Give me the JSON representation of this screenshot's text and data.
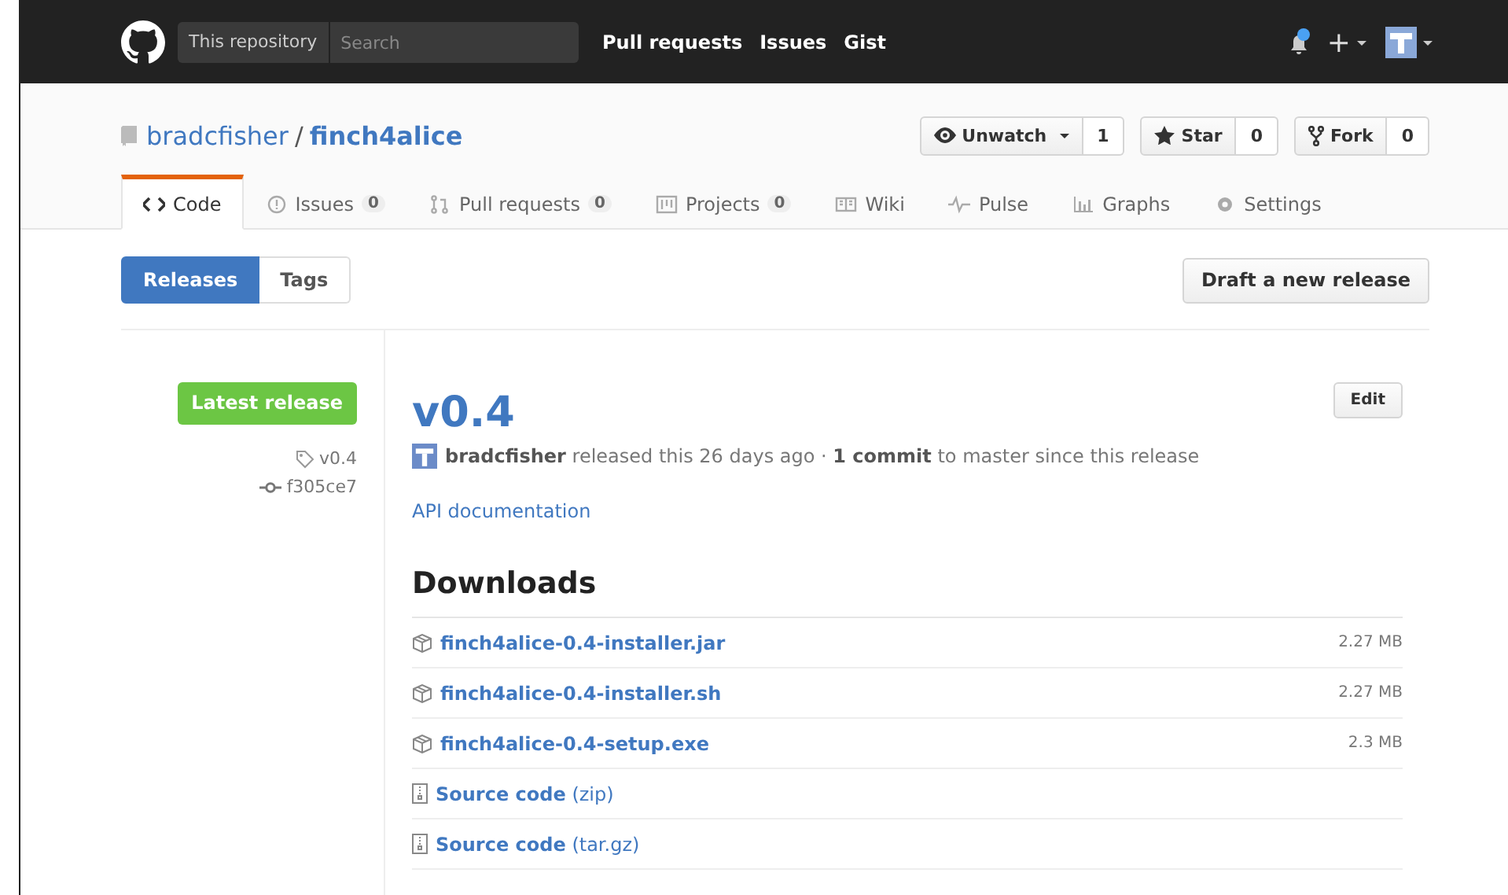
{
  "header": {
    "scope_label": "This repository",
    "search_placeholder": "Search",
    "nav": [
      "Pull requests",
      "Issues",
      "Gist"
    ],
    "notifications_unread": true,
    "new_symbol": "+"
  },
  "repo": {
    "owner": "bradcfisher",
    "separator": "/",
    "name": "finch4alice",
    "actions": [
      {
        "kind": "watch",
        "label": "Unwatch",
        "count": "1"
      },
      {
        "kind": "star",
        "label": "Star",
        "count": "0"
      },
      {
        "kind": "fork",
        "label": "Fork",
        "count": "0"
      }
    ]
  },
  "tabs": [
    {
      "kind": "code",
      "label": "Code",
      "selected": true
    },
    {
      "kind": "issues",
      "label": "Issues",
      "count": "0",
      "selected": false
    },
    {
      "kind": "pulls",
      "label": "Pull requests",
      "count": "0",
      "selected": false
    },
    {
      "kind": "projects",
      "label": "Projects",
      "count": "0",
      "selected": false
    },
    {
      "kind": "wiki",
      "label": "Wiki",
      "selected": false
    },
    {
      "kind": "pulse",
      "label": "Pulse",
      "selected": false
    },
    {
      "kind": "graphs",
      "label": "Graphs",
      "selected": false
    },
    {
      "kind": "settings",
      "label": "Settings",
      "selected": false
    }
  ],
  "subnav": [
    {
      "label": "Releases",
      "selected": true
    },
    {
      "label": "Tags",
      "selected": false
    }
  ],
  "draft_button": "Draft a new release",
  "release": {
    "badge": "Latest release",
    "tag": "v0.4",
    "commit": "f305ce7",
    "title": "v0.4",
    "edit_button": "Edit",
    "meta": "**bradcfisher** released this 26 days ago · **1 commit** to master since this release",
    "body_link": "API documentation",
    "downloads_title": "Downloads",
    "assets": [
      {
        "kind": "package",
        "name": "finch4alice-0.4-installer.jar",
        "size": "2.27 MB"
      },
      {
        "kind": "package",
        "name": "finch4alice-0.4-installer.sh",
        "size": "2.27 MB"
      },
      {
        "kind": "package",
        "name": "finch4alice-0.4-setup.exe",
        "size": "2.3 MB"
      },
      {
        "kind": "source",
        "name": "**Source code** (zip)"
      },
      {
        "kind": "source",
        "name": "**Source code** (tar.gz)"
      }
    ]
  }
}
